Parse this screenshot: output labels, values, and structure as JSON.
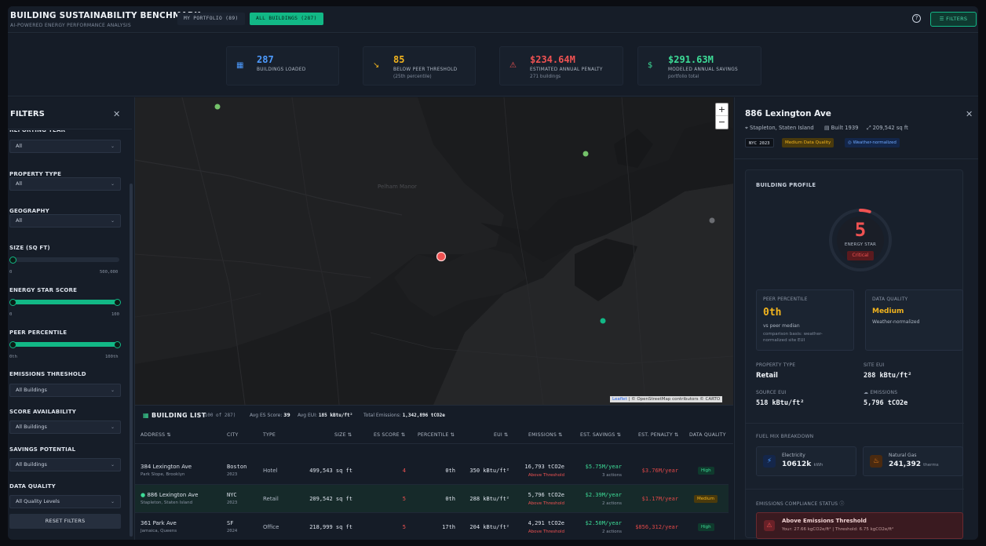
{
  "header": {
    "title": "BUILDING SUSTAINABILITY BENCHMARK",
    "subtitle": "AI-POWERED ENERGY PERFORMANCE ANALYSIS",
    "tab_portfolio": "MY PORTFOLIO (89)",
    "tab_all": "ALL BUILDINGS (287)",
    "help_icon": "?",
    "filters_button": "FILTERS"
  },
  "stats": [
    {
      "value": "287",
      "label": "BUILDINGS LOADED",
      "sub": "",
      "color": "#4d9bff",
      "icon": "building-icon"
    },
    {
      "value": "85",
      "label": "BELOW PEER THRESHOLD",
      "sub": "(25th percentile)",
      "color": "#f2b41e",
      "icon": "trend-down-icon"
    },
    {
      "value": "$234.64M",
      "label": "ESTIMATED ANNUAL PENALTY",
      "sub": "271 buildings",
      "color": "#f05252",
      "icon": "warning-icon"
    },
    {
      "value": "$291.63M",
      "label": "MODELED ANNUAL SAVINGS",
      "sub": "portfolio total",
      "color": "#3ddc97",
      "icon": "dollar-icon"
    }
  ],
  "filters": {
    "title": "FILTERS",
    "close": "✕",
    "reporting_year": {
      "label": "REPORTING YEAR",
      "value": "All"
    },
    "property_type": {
      "label": "PROPERTY TYPE",
      "value": "All"
    },
    "geography": {
      "label": "GEOGRAPHY",
      "value": "All"
    },
    "size": {
      "label": "SIZE (SQ FT)",
      "min": "0",
      "max": "500,000",
      "low": 0,
      "high": 0
    },
    "energy_star": {
      "label": "ENERGY STAR SCORE",
      "min": "0",
      "max": "100",
      "low": 0,
      "high": 100
    },
    "peer_percentile": {
      "label": "PEER PERCENTILE",
      "min": "0th",
      "max": "100th",
      "low": 0,
      "high": 100
    },
    "emissions_threshold": {
      "label": "EMISSIONS THRESHOLD",
      "value": "All Buildings"
    },
    "score_availability": {
      "label": "SCORE AVAILABILITY",
      "value": "All Buildings"
    },
    "savings_potential": {
      "label": "SAVINGS POTENTIAL",
      "value": "All Buildings"
    },
    "data_quality": {
      "label": "DATA QUALITY",
      "value": "All Quality Levels"
    },
    "reset": "RESET FILTERS"
  },
  "map": {
    "zoom_in": "+",
    "zoom_out": "−",
    "place_label": "Pelham Manor",
    "attribution_link": "Leaflet",
    "attribution_text": "| © OpenStreetMap contributors © CARTO"
  },
  "building_list": {
    "title": "BUILDING LIST",
    "count": "(100 of 287)",
    "avg_es_label": "Avg ES Score:",
    "avg_es": "39",
    "avg_eui_label": "Avg EUI:",
    "avg_eui": "185 kBtu/ft²",
    "total_em_label": "Total Emissions:",
    "total_em": "1,342,896 tCO2e",
    "columns": [
      "ADDRESS ⇅",
      "CITY",
      "TYPE",
      "SIZE ⇅",
      "ES SCORE ⇅",
      "PERCENTILE ⇅",
      "EUI ⇅",
      "EMISSIONS ⇅",
      "EST. SAVINGS ⇅",
      "EST. PENALTY ⇅",
      "DATA QUALITY"
    ],
    "rows": [
      {
        "address": "384 Lexington Ave",
        "area": "Park Slope, Brooklyn",
        "city": "Boston",
        "year": "2023",
        "type": "Hotel",
        "size": "499,543 sq ft",
        "es": "4",
        "pct": "0th",
        "eui": "350 kBtu/ft²",
        "emissions": "16,793 tCO2e",
        "threshold": "Above Threshold",
        "savings": "$5.75M/year",
        "actions": "3 actions",
        "penalty": "$3.76M/year",
        "quality": "High"
      },
      {
        "address": "886 Lexington Ave",
        "area": "Stapleton, Staten Island",
        "city": "NYC",
        "year": "2023",
        "type": "Retail",
        "size": "209,542 sq ft",
        "es": "5",
        "pct": "0th",
        "eui": "288 kBtu/ft²",
        "emissions": "5,796 tCO2e",
        "threshold": "Above Threshold",
        "savings": "$2.39M/year",
        "actions": "2 actions",
        "penalty": "$1.17M/year",
        "quality": "Medium"
      },
      {
        "address": "361 Park Ave",
        "area": "Jamaica, Queens",
        "city": "SF",
        "year": "2024",
        "type": "Office",
        "size": "218,999 sq ft",
        "es": "5",
        "pct": "17th",
        "eui": "204 kBtu/ft²",
        "emissions": "4,291 tCO2e",
        "threshold": "Above Threshold",
        "savings": "$2.50M/year",
        "actions": "2 actions",
        "penalty": "$856,312/year",
        "quality": "High"
      }
    ]
  },
  "detail": {
    "name": "886 Lexington Ave",
    "close": "✕",
    "location": "Stapleton, Staten Island",
    "built": "Built 1939",
    "size": "209,542 sq ft",
    "tags": [
      "NYC 2023",
      "Medium Data Quality",
      "Weather-normalized"
    ],
    "profile_title": "BUILDING PROFILE",
    "score": "5",
    "score_label": "ENERGY STAR",
    "score_status": "Critical",
    "score_fraction": 0.05,
    "peer_label": "PEER PERCENTILE",
    "peer_value": "0th",
    "peer_sub": "vs peer median",
    "peer_note": "comparison basis: weather-normalized site EUI",
    "dq_label": "DATA QUALITY",
    "dq_value": "Medium",
    "dq_sub": "Weather-normalized",
    "ptype_label": "PROPERTY TYPE",
    "ptype": "Retail",
    "site_eui_label": "SITE EUI",
    "site_eui": "288 kBtu/ft²",
    "source_eui_label": "SOURCE EUI",
    "source_eui": "518 kBtu/ft²",
    "emissions_label": "EMISSIONS",
    "emissions": "5,796 tCO2e",
    "fuel_title": "FUEL MIX BREAKDOWN",
    "elec_label": "Electricity",
    "elec_value": "10612k",
    "elec_unit": "kWh",
    "gas_label": "Natural Gas",
    "gas_value": "241,392",
    "gas_unit": "therms",
    "compliance_title": "EMISSIONS COMPLIANCE STATUS",
    "alert_title": "Above Emissions Threshold",
    "alert_text": "Your: 27.66 kgCO2e/ft² | Threshold: 6.75 kgCO2e/ft²"
  }
}
